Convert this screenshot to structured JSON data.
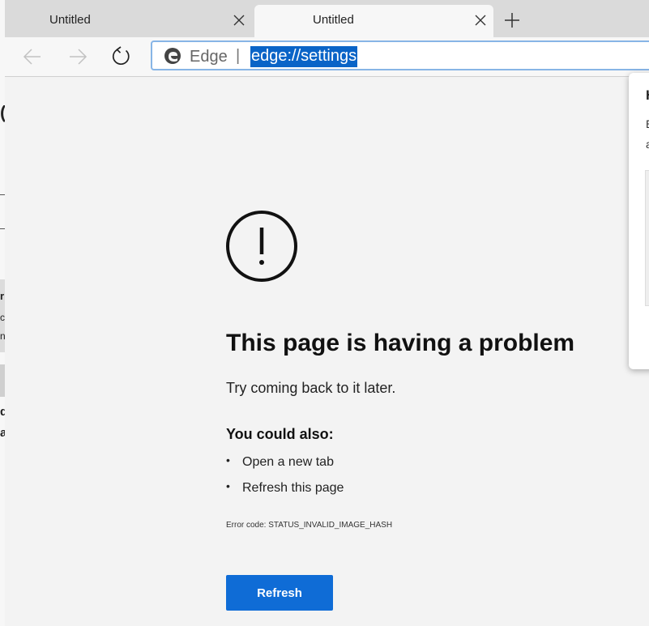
{
  "tabs": [
    {
      "title": "Untitled",
      "active": false
    },
    {
      "title": "Untitled",
      "active": true
    }
  ],
  "address": {
    "site_label": "Edge",
    "separator": "|",
    "url": "edge://settings"
  },
  "error": {
    "title": "This page is having a problem",
    "subtitle": "Try coming back to it later.",
    "also_heading": "You could also:",
    "suggestions": [
      "Open a new tab",
      "Refresh this page"
    ],
    "code": "Error code: STATUS_INVALID_IMAGE_HASH",
    "button_label": "Refresh"
  },
  "flyout": {
    "heading": "H",
    "line1": "E",
    "line2": "a"
  },
  "behind_window": {
    "fragments": [
      "(",
      "r",
      "c",
      "n",
      "d",
      "a"
    ]
  },
  "colors": {
    "accent": "#0f6cd6",
    "url_selection": "#0a64c7",
    "address_border": "#87b5e6",
    "page_background": "#f3f3f3"
  },
  "icons": {
    "tab_close": "close-icon",
    "new_tab": "plus-icon",
    "back": "arrow-left-icon",
    "forward": "arrow-right-icon",
    "reload": "refresh-icon",
    "site": "edge-logo-icon",
    "error": "exclamation-circle-icon"
  }
}
